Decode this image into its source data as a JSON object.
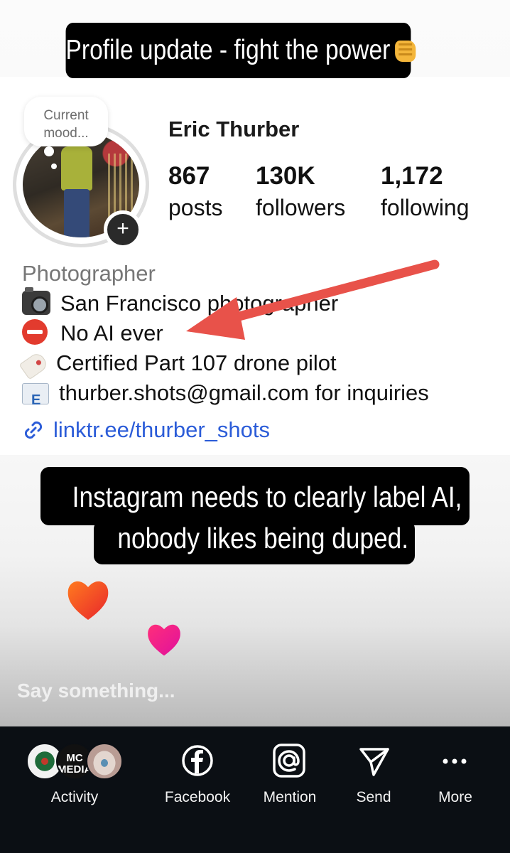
{
  "story": {
    "caption_top": "Profile update - fight the power",
    "caption_middle_line1": "Instagram needs to clearly label AI,",
    "caption_middle_line2": "nobody likes being duped."
  },
  "profile": {
    "mood_bubble": "Current mood...",
    "name": "Eric Thurber",
    "stats": {
      "posts_value": "867",
      "posts_label": "posts",
      "followers_value": "130K",
      "followers_label": "followers",
      "following_value": "1,172",
      "following_label": "following"
    },
    "bio": {
      "category": "Photographer",
      "line1": "San Francisco photographer",
      "line2": "No AI ever",
      "line3": "Certified Part 107 drone pilot",
      "line4": "thurber.shots@gmail.com for inquiries",
      "link": "linktr.ee/thurber_shots"
    }
  },
  "icons": {
    "plus": "plus-icon",
    "camera": "camera-emoji",
    "no_entry": "no-entry-emoji",
    "tag": "label-tag-emoji",
    "mail": "mail-emoji",
    "link": "link-icon",
    "arrow": "red-arrow-annotation",
    "fist": "fist-emoji"
  },
  "comment": {
    "placeholder": "Say something..."
  },
  "share_bar": {
    "activity_label": "Activity",
    "facebook_label": "Facebook",
    "mention_label": "Mention",
    "send_label": "Send",
    "more_label": "More",
    "avatar2_text": "MC MEDIA"
  },
  "colors": {
    "arrow": "#e8524a",
    "link": "#2b5cd8",
    "share_bar_bg": "#0b0f14"
  }
}
